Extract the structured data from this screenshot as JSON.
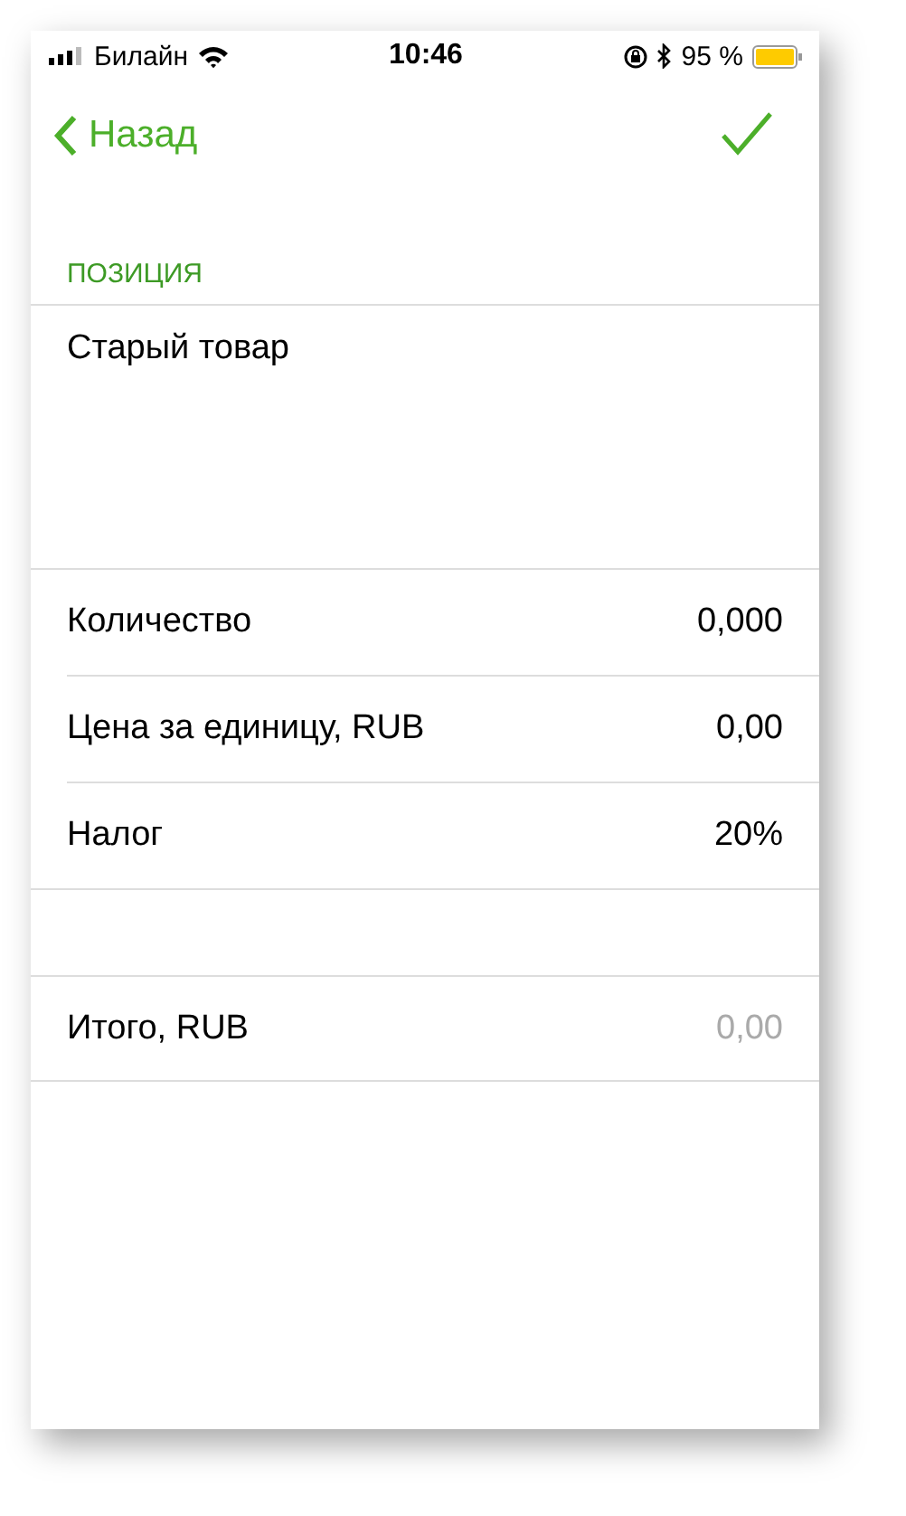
{
  "status_bar": {
    "carrier": "Билайн",
    "time": "10:46",
    "battery": "95 %"
  },
  "nav": {
    "back": "Назад"
  },
  "section": {
    "header": "ПОЗИЦИЯ",
    "name": "Старый товар"
  },
  "rows": [
    {
      "label": "Количество",
      "value": "0,000",
      "dimmed": false
    },
    {
      "label": "Цена за единицу, RUB",
      "value": "0,00",
      "dimmed": false
    },
    {
      "label": "Налог",
      "value": "20%",
      "dimmed": false
    }
  ],
  "total": {
    "label": "Итого, RUB",
    "value": "0,00",
    "dimmed": true
  }
}
